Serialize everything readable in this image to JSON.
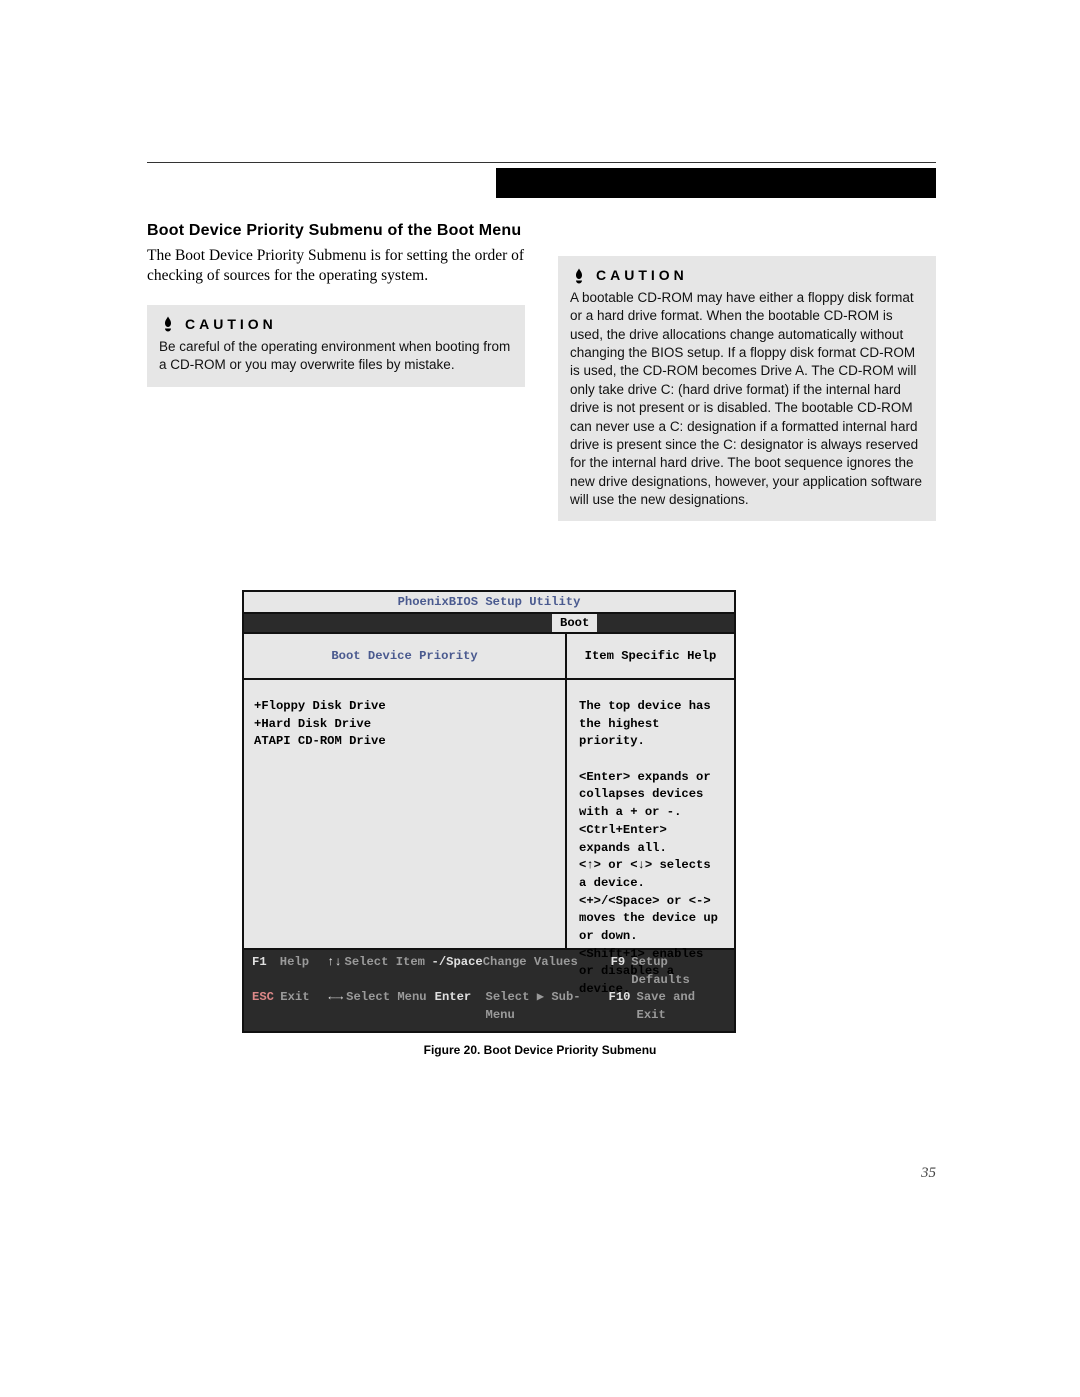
{
  "section_title": "Boot Device Priority Submenu of the Boot Menu",
  "intro": "The Boot Device Priority Submenu is for setting the order of checking of sources for the operating system.",
  "caution_label": "CAUTION",
  "caution_left": "Be careful of the operating environment when booting from a CD-ROM or you may overwrite files by mistake.",
  "caution_right": "A bootable CD-ROM may have either a floppy disk format or a hard drive format. When the bootable CD-ROM is used, the drive allocations change automatically without changing the BIOS setup. If a floppy disk format CD-ROM is used, the CD-ROM becomes Drive A. The CD-ROM will only take drive C: (hard drive format) if the internal hard drive is not present or is disabled. The bootable CD-ROM can never use a C: designation if a formatted internal hard drive is present since the C: designator is always reserved for the internal hard drive. The boot sequence ignores the new drive designations, however, your application software will use the new designations.",
  "bios": {
    "title": "PhoenixBIOS Setup Utility",
    "tab": "Boot",
    "left_heading": "Boot Device Priority",
    "devices": [
      "+Floppy Disk Drive",
      "+Hard Disk Drive",
      " ATAPI CD-ROM Drive"
    ],
    "right_heading": "Item Specific Help",
    "help_text": "The top device has the highest priority.\n\n<Enter> expands or collapses devices with a + or -.\n<Ctrl+Enter> expands all.\n<↑> or <↓> selects a device.\n<+>/<Space> or <-> moves the device up or down.\n<Shift+1> enables or disables a device.",
    "footer": {
      "r1": {
        "k1": "F1",
        "l1": "Help",
        "a1": "↑↓",
        "al1": "Select Item",
        "v1k": "-/Space",
        "v1l": "Change Values",
        "rk": "F9",
        "rl": "Setup Defaults"
      },
      "r2": {
        "k1": "ESC",
        "l1": "Exit",
        "a1": "←→",
        "al1": "Select Menu",
        "v1k": "Enter",
        "v1l": "Select ▶ Sub-Menu",
        "rk": "F10",
        "rl": "Save and Exit"
      }
    }
  },
  "figure_caption": "Figure 20.  Boot Device Priority Submenu",
  "page_number": "35"
}
